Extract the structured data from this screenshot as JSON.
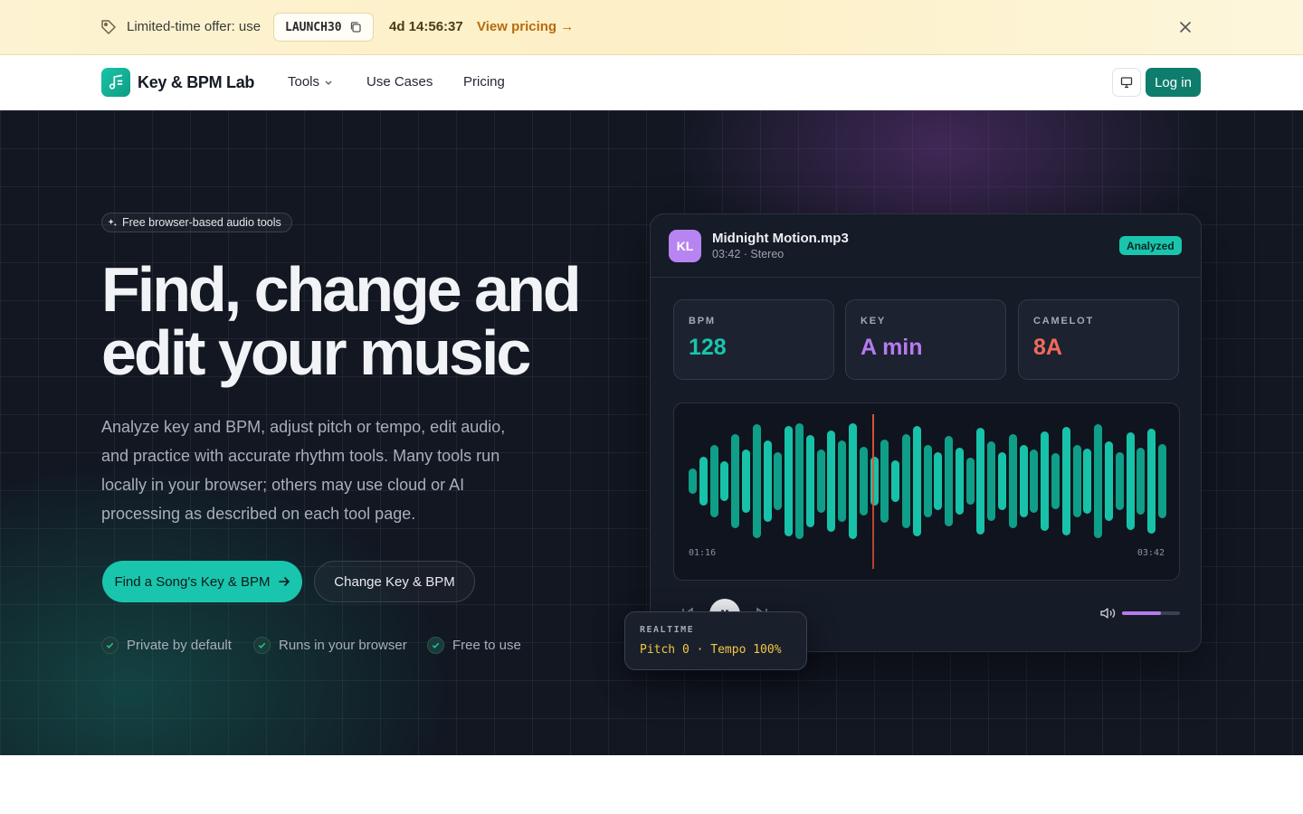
{
  "promo": {
    "text": "Limited-time offer: use",
    "code": "LAUNCH30",
    "countdown": "4d 14:56:37",
    "link": "View pricing →"
  },
  "nav": {
    "brand": "Key & BPM Lab",
    "links": [
      "Tools",
      "Use Cases",
      "Pricing"
    ],
    "login": "Log in"
  },
  "hero": {
    "pill": "Free browser-based audio tools",
    "headline_line1": "Find, change and",
    "headline_line2": "edit your music",
    "subtext": "Analyze key and BPM, adjust pitch or tempo, edit audio, and practice with accurate rhythm tools. Many tools run locally in your browser; others may use cloud or AI processing as described on each tool page.",
    "cta_primary": "Find a Song's Key & BPM",
    "cta_secondary": "Change Key & BPM",
    "features": [
      "Private by default",
      "Runs in your browser",
      "Free to use"
    ]
  },
  "player": {
    "avatar": "KL",
    "file_name": "Midnight Motion.mp3",
    "file_meta": "03:42 · Stereo",
    "status": "Analyzed",
    "stats": [
      {
        "label": "BPM",
        "value": "128",
        "color": "#19c5ad"
      },
      {
        "label": "KEY",
        "value": "A min",
        "color": "#b57bee"
      },
      {
        "label": "CAMELOT",
        "value": "8A",
        "color": "#f26a5c"
      }
    ],
    "time_current": "01:16",
    "time_total": "03:42",
    "volume_level": 0.67,
    "waveform": [
      0.22,
      0.42,
      0.62,
      0.35,
      0.82,
      0.55,
      0.98,
      0.7,
      0.5,
      0.95,
      1.0,
      0.8,
      0.55,
      0.88,
      0.7,
      1.0,
      0.6,
      0.42,
      0.72,
      0.36,
      0.82,
      0.95,
      0.62,
      0.5,
      0.78,
      0.58,
      0.4,
      0.92,
      0.68,
      0.5,
      0.82,
      0.62,
      0.55,
      0.86,
      0.48,
      0.94,
      0.62,
      0.56,
      0.98,
      0.68,
      0.5,
      0.84,
      0.58,
      0.9,
      0.64
    ],
    "realtime_label": "REALTIME",
    "realtime_value": "Pitch 0 · Tempo 100%"
  },
  "colors": {
    "accent": "#19c5ad",
    "brand_button": "#0e7d6c",
    "key_accent": "#b57bee",
    "camelot_accent": "#f26a5c"
  },
  "icons": {
    "promo": "tag-icon",
    "copy": "copy-icon",
    "close": "close-icon",
    "logo": "music-note-icon",
    "theme": "monitor-icon",
    "pill": "sparkles-icon"
  }
}
